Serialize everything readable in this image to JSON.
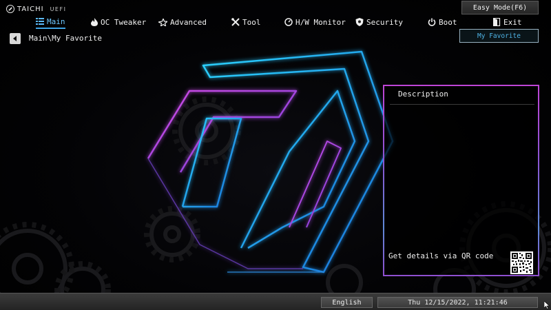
{
  "header": {
    "brand": "TAICHI",
    "brand_suffix": "UEFI",
    "easy_mode_label": "Easy Mode(F6)"
  },
  "nav": {
    "active": "Main",
    "tabs": [
      {
        "id": "main",
        "label": "Main",
        "icon": "list-icon"
      },
      {
        "id": "oc",
        "label": "OC Tweaker",
        "icon": "flame-icon"
      },
      {
        "id": "advanced",
        "label": "Advanced",
        "icon": "star-icon"
      },
      {
        "id": "tool",
        "label": "Tool",
        "icon": "tools-icon"
      },
      {
        "id": "hw",
        "label": "H/W Monitor",
        "icon": "monitor-dial-icon"
      },
      {
        "id": "security",
        "label": "Security",
        "icon": "shield-icon"
      },
      {
        "id": "boot",
        "label": "Boot",
        "icon": "power-icon"
      },
      {
        "id": "exit",
        "label": "Exit",
        "icon": "exit-door-icon"
      }
    ]
  },
  "breadcrumb": "Main\\My Favorite",
  "my_favorite_label": "My Favorite",
  "description": {
    "title": "Description",
    "qr_label": "Get details via QR code"
  },
  "footer": {
    "language": "English",
    "datetime": "Thu 12/15/2022, 11:21:46"
  },
  "colors": {
    "accent_cyan": "#3fa6e8",
    "accent_magenta": "#bf45d6",
    "panel_border": "#8b55d4"
  }
}
